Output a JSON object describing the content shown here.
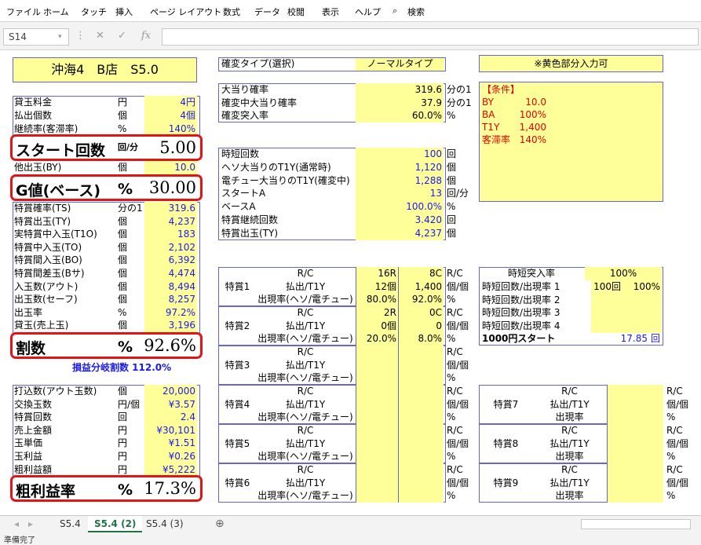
{
  "menu": [
    "ファイル",
    "ホーム",
    "タッチ",
    "挿入",
    "ページ レイアウト",
    "数式",
    "データ",
    "校閲",
    "表示",
    "ヘルプ",
    "検索"
  ],
  "namebox": "S14",
  "fx": "fx",
  "title": "沖海4　B店　S5.0",
  "kakuhen": {
    "label": "確変タイプ(選択)",
    "value": "ノーマルタイプ"
  },
  "note": "※黄色部分入力可",
  "conditions": {
    "title": "【条件】",
    "rows": [
      [
        "BY",
        "10.0"
      ],
      [
        "BA",
        "100%"
      ],
      [
        "T1Y",
        "1,400"
      ],
      [
        "客滞率",
        "140%"
      ]
    ]
  },
  "left1": [
    [
      "貸玉料金",
      "円",
      "4円"
    ],
    [
      "払出個数",
      "個",
      "4個"
    ],
    [
      "継続率(客滞率)",
      "%",
      "140%"
    ]
  ],
  "start": {
    "label": "スタート回数",
    "unit": "回/分",
    "value": "5.00"
  },
  "bypass": [
    "他出玉(BY)",
    "個",
    "10.0"
  ],
  "gvalue": {
    "label": "G値(ベース)",
    "unit": "%",
    "value": "30.00"
  },
  "left2": [
    [
      "特賞確率(TS)",
      "分の1",
      "319.6"
    ],
    [
      "特賞出玉(TY)",
      "個",
      "4,237"
    ],
    [
      "実特賞中入玉(T1O)",
      "個",
      "183"
    ],
    [
      "特賞中入玉(TO)",
      "個",
      "2,102"
    ],
    [
      "特賞間入玉(BO)",
      "個",
      "6,392"
    ],
    [
      "特賞間差玉(Bサ)",
      "個",
      "4,474"
    ],
    [
      "入玉数(アウト)",
      "個",
      "8,494"
    ],
    [
      "出玉数(セーフ)",
      "個",
      "8,257"
    ],
    [
      "出玉率",
      "%",
      "97.2%"
    ],
    [
      "貸玉(売上玉)",
      "個",
      "3,196"
    ]
  ],
  "warisu": {
    "label": "割数",
    "unit": "%",
    "value": "92.6%"
  },
  "breakeven": "損益分岐割数 112.0%",
  "left3": [
    [
      "打込数(アウト玉数)",
      "個",
      "20,000"
    ],
    [
      "交換玉数",
      "円/個",
      "¥3.57"
    ],
    [
      "特賞回数",
      "回",
      "2.4"
    ],
    [
      "売上金額",
      "円",
      "¥30,101"
    ],
    [
      "玉単価",
      "円",
      "¥1.51"
    ],
    [
      "玉利益",
      "円",
      "¥0.26"
    ],
    [
      "粗利益額",
      "円",
      "¥5,222"
    ]
  ],
  "arari": {
    "label": "粗利益率",
    "unit": "%",
    "value": "17.3%"
  },
  "mid1": [
    [
      "大当り確率",
      "319.6",
      "分の1"
    ],
    [
      "確変中大当り確率",
      "37.9",
      "分の1"
    ],
    [
      "確変突入率",
      "60.0%",
      "%"
    ]
  ],
  "mid2": [
    [
      "時短回数",
      "100",
      "回"
    ],
    [
      "ヘソ大当りのT1Y(通常時)",
      "1,120",
      "個"
    ],
    [
      "電チュー大当りのT1Y(確変中)",
      "1,288",
      "個"
    ],
    [
      "スタートA",
      "13",
      "回/分"
    ],
    [
      "ベースA",
      "100.0%",
      "%"
    ],
    [
      "特賞継続回数",
      "3.420",
      "回"
    ],
    [
      "特賞出玉(TY)",
      "4,237",
      "個"
    ]
  ],
  "tokushou_rows": [
    "R/C",
    "払出/T1Y",
    "出現率(ヘソ/電チュー)"
  ],
  "tokushou_units": [
    "R/C",
    "個/個",
    "%"
  ],
  "tokushou": [
    {
      "name": "特賞1",
      "v": [
        [
          "16R",
          "8C"
        ],
        [
          "12個",
          "1,400"
        ],
        [
          "80.0%",
          "92.0%"
        ]
      ]
    },
    {
      "name": "特賞2",
      "v": [
        [
          "2R",
          "0C"
        ],
        [
          "0個",
          "0"
        ],
        [
          "20.0%",
          "8.0%"
        ]
      ]
    },
    {
      "name": "特賞3",
      "v": [
        [
          "",
          ""
        ],
        [
          "",
          ""
        ],
        [
          "",
          ""
        ]
      ]
    },
    {
      "name": "特賞4",
      "v": [
        [
          "",
          ""
        ],
        [
          "",
          ""
        ],
        [
          "",
          ""
        ]
      ]
    },
    {
      "name": "特賞5",
      "v": [
        [
          "",
          ""
        ],
        [
          "",
          ""
        ],
        [
          "",
          ""
        ]
      ]
    },
    {
      "name": "特賞6",
      "v": [
        [
          "",
          ""
        ],
        [
          "",
          ""
        ],
        [
          "",
          ""
        ]
      ]
    }
  ],
  "jitan": {
    "header": "時短突入率",
    "rate": "100%",
    "rows": [
      [
        "時短回数/出現率 1",
        "100回",
        "100%"
      ],
      [
        "時短回数/出現率 2",
        "",
        ""
      ],
      [
        "時短回数/出現率 3",
        "",
        ""
      ],
      [
        "時短回数/出現率 4",
        "",
        ""
      ]
    ],
    "start_label": "1000円スタート",
    "start_value": "17.85",
    "start_unit": "回"
  },
  "right_rows": [
    "R/C",
    "払出/T1Y",
    "出現率"
  ],
  "right_units": [
    "R/C",
    "個/個",
    "%"
  ],
  "right_tokushou": [
    "特賞7",
    "特賞8",
    "特賞9"
  ],
  "tabs": [
    "S5.4",
    "S5.4 (2)",
    "S5.4 (3)"
  ],
  "status": "準備完了"
}
